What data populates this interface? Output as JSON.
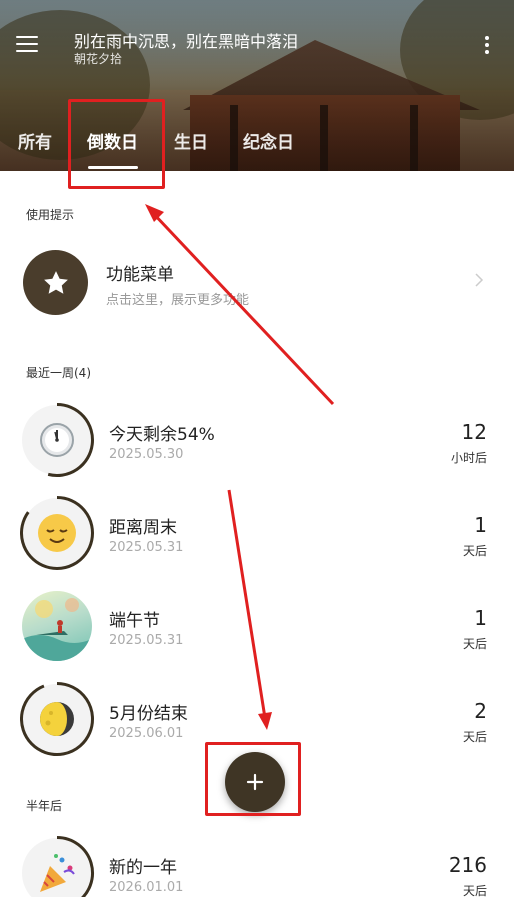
{
  "header": {
    "quote": "别在雨中沉思，别在黑暗中落泪",
    "author": "朝花夕拾",
    "menu_icon": "hamburger-menu-icon",
    "more_icon": "more-vertical-icon"
  },
  "tabs": [
    {
      "label": "所有",
      "active": false
    },
    {
      "label": "倒数日",
      "active": true
    },
    {
      "label": "生日",
      "active": false
    },
    {
      "label": "纪念日",
      "active": false
    }
  ],
  "tips": {
    "section_label": "使用提示",
    "title": "功能菜单",
    "subtitle": "点击这里，展示更多功能",
    "icon": "star-icon"
  },
  "recent_week": {
    "section_label": "最近一周(4)",
    "items": [
      {
        "title": "今天剩余54%",
        "date": "2025.05.30",
        "count": "12",
        "unit": "小时后",
        "icon": "clock-emoji-icon",
        "progress": 0.54
      },
      {
        "title": "距离周末",
        "date": "2025.05.31",
        "count": "1",
        "unit": "天后",
        "icon": "relieved-face-emoji-icon",
        "progress": 0.85
      },
      {
        "title": "端午节",
        "date": "2025.05.31",
        "count": "1",
        "unit": "天后",
        "icon": "dragon-boat-festival-image",
        "progress": null
      },
      {
        "title": "5月份结束",
        "date": "2025.06.01",
        "count": "2",
        "unit": "天后",
        "icon": "moon-phase-emoji-icon",
        "progress": 0.94
      }
    ]
  },
  "half_year": {
    "section_label": "半年后",
    "items": [
      {
        "title": "新的一年",
        "date": "2026.01.01",
        "count": "216",
        "unit": "天后",
        "icon": "party-popper-emoji-icon",
        "progress": 0.41
      }
    ]
  },
  "fab": {
    "icon": "plus-icon"
  },
  "colors": {
    "accent": "#3f3525",
    "annotation_red": "#e02020",
    "ring": "#3b3120"
  }
}
